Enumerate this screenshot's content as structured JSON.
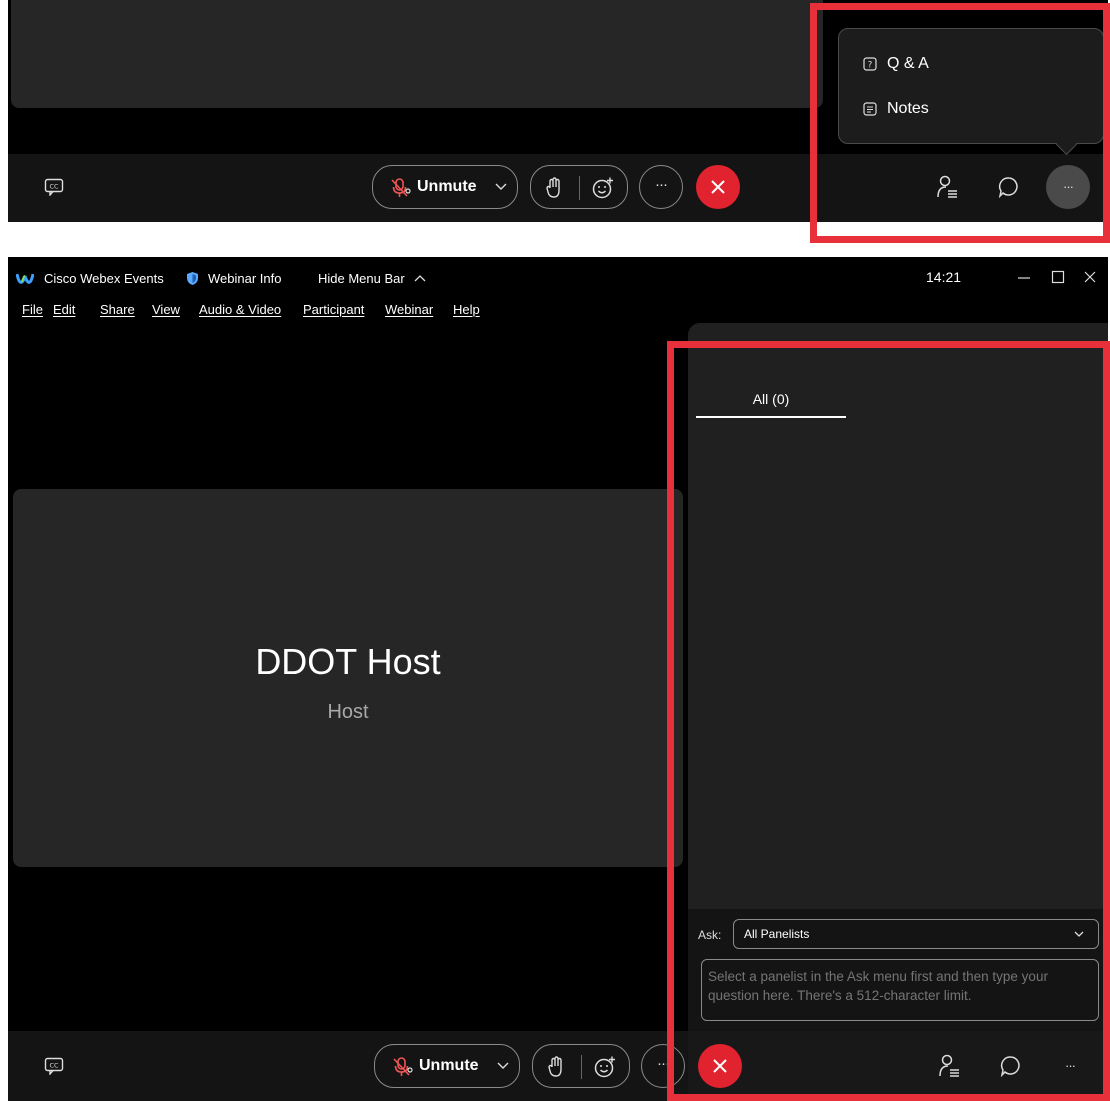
{
  "overlay_menu": {
    "items": [
      {
        "label": "Q & A",
        "icon": "qa-icon"
      },
      {
        "label": "Notes",
        "icon": "notes-icon"
      }
    ]
  },
  "toolbar": {
    "unmute_label": "Unmute",
    "more_label": "···"
  },
  "titlebar": {
    "app_name": "Cisco Webex Events",
    "webinar_info": "Webinar Info",
    "hide_menu_bar": "Hide Menu Bar",
    "time": "14:21"
  },
  "menubar": {
    "items": [
      "File",
      "Edit",
      "Share",
      "View",
      "Audio & Video",
      "Participant",
      "Webinar",
      "Help"
    ]
  },
  "stage": {
    "host_name": "DDOT Host",
    "host_role": "Host"
  },
  "qa_panel": {
    "tab_label": "All (0)",
    "ask_label": "Ask:",
    "ask_selected": "All Panelists",
    "question_placeholder": "Select a panelist in the Ask menu first and then type your question here. There's a 512-character limit."
  },
  "colors": {
    "leave_red": "#e0232e",
    "highlight_red": "#e8303b",
    "panel_bg": "#202020",
    "toolbar_bg": "#141414"
  }
}
